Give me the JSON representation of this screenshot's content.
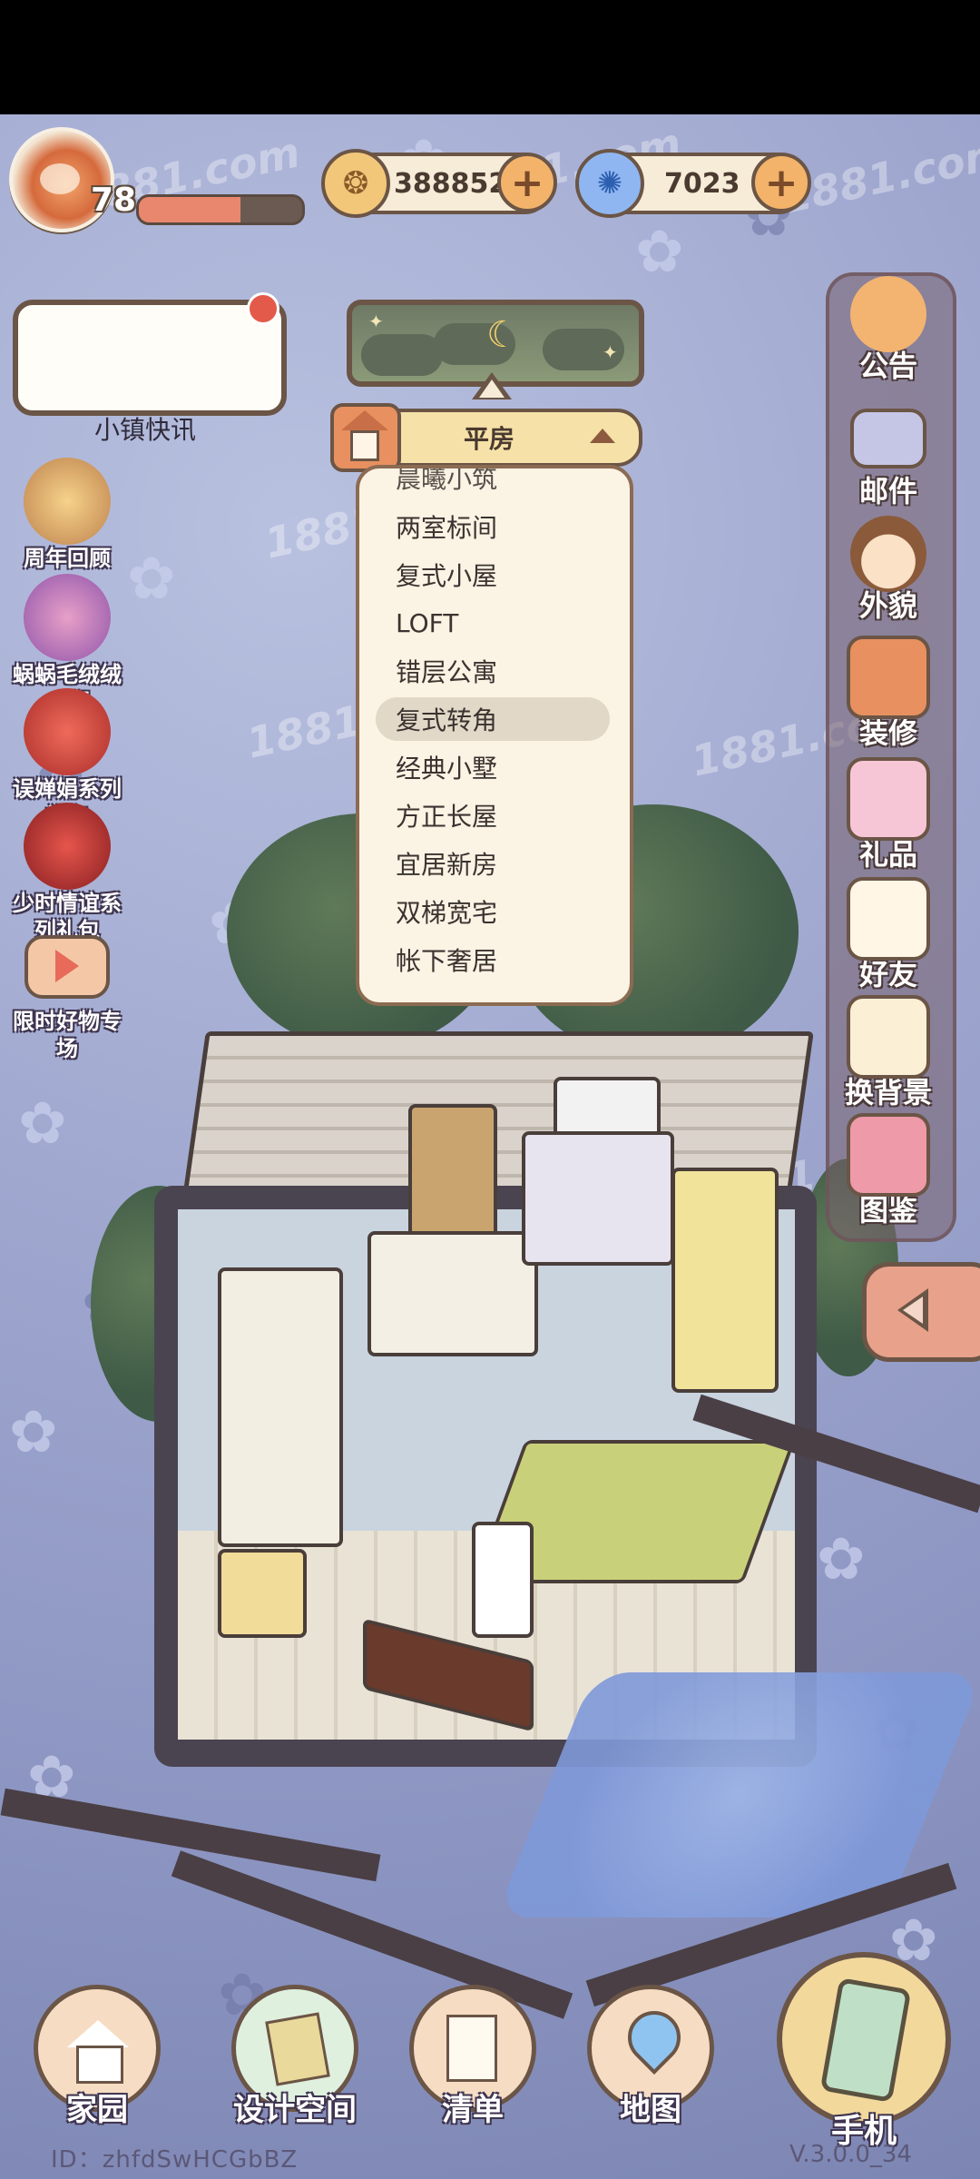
{
  "player": {
    "level": "78",
    "xp_fraction": 0.62,
    "id_label": "ID：zhfdSwHCGbBZ"
  },
  "currencies": [
    {
      "icon": "gold-coin-icon",
      "value": "388852",
      "add": "+"
    },
    {
      "icon": "blue-swirl-gem-icon",
      "value": "7023",
      "add": "+"
    }
  ],
  "news": {
    "label": "小镇快讯"
  },
  "events": [
    {
      "icon": "film-reel-icon",
      "label": "周年回顾"
    },
    {
      "icon": "plush-snail-icon",
      "label": "蜗蜗毛绒绒·3期"
    },
    {
      "icon": "red-flower-icon",
      "label": "误婵娟系列礼包"
    },
    {
      "icon": "red-rose-icon",
      "label": "少时情谊系列礼包"
    },
    {
      "icon": "play-video-icon",
      "label": "限时好物专场"
    }
  ],
  "house_selector": {
    "selected": "平房",
    "options_cut": "晨曦小筑",
    "options": [
      "两室标间",
      "复式小屋",
      "LOFT",
      "错层公寓",
      "复式转角",
      "经典小墅",
      "方正长屋",
      "宜居新房",
      "双梯宽宅",
      "帐下奢居"
    ],
    "highlighted": "复式转角"
  },
  "sidebar": [
    {
      "icon": "megaphone-icon",
      "label": "公告"
    },
    {
      "icon": "envelope-icon",
      "label": "邮件"
    },
    {
      "icon": "character-face-icon",
      "label": "外貌"
    },
    {
      "icon": "house-wrench-icon",
      "label": "装修"
    },
    {
      "icon": "gift-box-icon",
      "label": "礼品"
    },
    {
      "icon": "friend-notebook-icon",
      "label": "好友"
    },
    {
      "icon": "background-swap-icon",
      "label": "换背景"
    },
    {
      "icon": "album-book-icon",
      "label": "图鉴"
    }
  ],
  "bottom_nav": [
    {
      "icon": "home-icon",
      "label": "家园"
    },
    {
      "icon": "design-ruler-icon",
      "label": "设计空间"
    },
    {
      "icon": "checklist-quill-icon",
      "label": "清单"
    },
    {
      "icon": "map-pin-icon",
      "label": "地图"
    }
  ],
  "phone": {
    "icon": "phone-icon",
    "label": "手机"
  },
  "version": "V.3.0.0_34",
  "watermark": "1881.com",
  "colors": {
    "frame": "#6b5546",
    "panel": "#fbf3e3",
    "accent": "#e8905f",
    "sky": "#9fa7cf"
  }
}
